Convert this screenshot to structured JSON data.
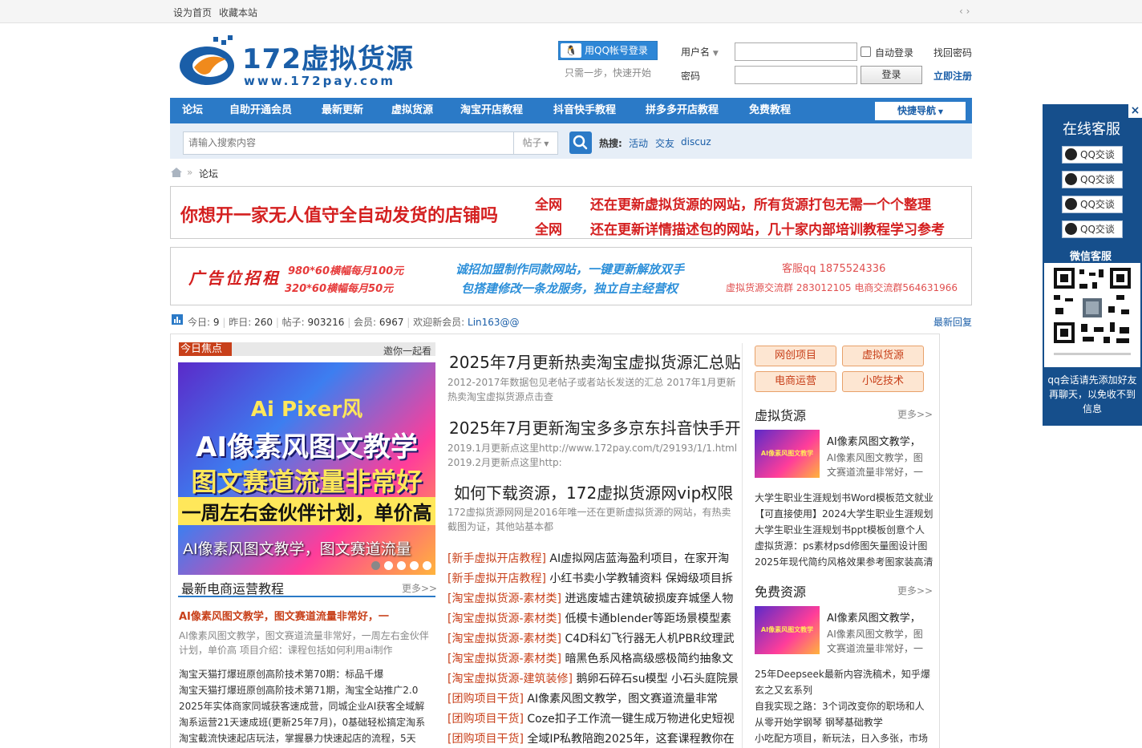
{
  "topbar": {
    "set_home": "设为首页",
    "bookmark": "收藏本站",
    "toggle": "‹ ›"
  },
  "logo": {
    "title": "172虚拟货源",
    "url": "www.172pay.com"
  },
  "login": {
    "qq_button": "用QQ帐号登录",
    "qq_hint": "只需一步，快速开始",
    "username_label": "用户名",
    "password_label": "密码",
    "auto_login": "自动登录",
    "login_button": "登录",
    "find_password": "找回密码",
    "register": "立即注册"
  },
  "nav": {
    "items": [
      "论坛",
      "自助开通会员",
      "最新更新",
      "虚拟货源",
      "淘宝开店教程",
      "抖音快手教程",
      "拼多多开店教程",
      "免费教程"
    ],
    "quick_nav": "快捷导航"
  },
  "search": {
    "placeholder": "请输入搜索内容",
    "type": "帖子",
    "hot_label": "热搜:",
    "hot": [
      "活动",
      "交友",
      "discuz"
    ]
  },
  "breadcrumb": {
    "current": "论坛"
  },
  "banner1": {
    "left": "你想开一家无人值守全自动发货的店铺吗",
    "tag1": "全网",
    "line1": "还在更新虚拟货源的网站，所有货源打包无需一个个整理",
    "tag2": "全网",
    "line2": "还在更新详情描述包的网站，几十家内部培训教程学习参考"
  },
  "banner2": {
    "title": "广告位招租",
    "price1": "980*60横幅每月100元",
    "price2": "320*60横幅每月50元",
    "promo1": "诚招加盟制作同款网站，一键更新解放双手",
    "promo2": "包搭建修改一条龙服务，独立自主经营权",
    "kf": "客服qq  1875524336",
    "group": "虚拟货源交流群  283012105  电商交流群564631966"
  },
  "stats": {
    "today_label": "今日:",
    "today": "9",
    "yesterday_label": "昨日:",
    "yesterday": "260",
    "posts_label": "帖子:",
    "posts": "903216",
    "members_label": "会员:",
    "members": "6967",
    "newest_label": "欢迎新会员:",
    "newest": "Lin163@@",
    "latest_reply": "最新回复"
  },
  "focus": {
    "tag": "今日焦点",
    "invite": "邀你一起看",
    "slide_caption": "AI像素风图文教学，图文赛道流量",
    "slide_l1": "Ai Pixer风",
    "slide_l2": "AI像素风图文教学",
    "slide_l3": "图文赛道流量非常好",
    "slide_l4": "一周左右金伙伴计划，单价高"
  },
  "ecom": {
    "title": "最新电商运营教程",
    "more": "更多>>",
    "headline": "AI像素风图文教学，图文赛道流量非常好，一",
    "desc1": "AI像素风图文教学，图文赛道流量非常好，一周左右金伙伴",
    "desc2": "计划，单价高 项目介绍：课程包括如何利用ai制作",
    "list": [
      "淘宝天猫打爆班原创高阶技术第70期：标品千爆",
      "淘宝天猫打爆班原创高阶技术第71期，淘宝全站推广2.0",
      "2025年实体商家同城获客速成营，同城企业AI获客全域解",
      "淘系运营21天速成班(更新25年7月)，0基础轻松搞定淘系",
      "淘宝截流快速起店玩法，掌握暴力快速起店的流程，5天"
    ]
  },
  "middle": {
    "t1": "2025年7月更新热卖淘宝虚拟货源汇总贴",
    "d1": "2012-2017年数据包见老帖子或者站长发送的汇总 2017年1月更新热卖淘宝虚拟货源点击查",
    "t2": "2025年7月更新淘宝多多京东抖音快手开",
    "d2a": "2019.1月更新点这里http://www.172pay.com/t/29193/1/1.html",
    "d2b": "2019.2月更新点这里http:",
    "t3": "如何下载资源，172虚拟货源网vip权限",
    "d3": "172虚拟货源网网是2016年唯一还在更新虚拟货源的网站，有热卖截图为证，其他站基本都",
    "items": [
      {
        "tag": "[新手虚拟开店教程]",
        "text": "AI虚拟网店蓝海盈利项目，在家开淘"
      },
      {
        "tag": "[新手虚拟开店教程]",
        "text": "小红书卖小学教辅资料 保姆级项目拆"
      },
      {
        "tag": "[淘宝虚拟货源-素材类]",
        "text": "迸逃废墟古建筑破损废弃城堡人物"
      },
      {
        "tag": "[淘宝虚拟货源-素材类]",
        "text": "低模卡通blender等距场景模型素"
      },
      {
        "tag": "[淘宝虚拟货源-素材类]",
        "text": "C4D科幻飞行器无人机PBR纹理武"
      },
      {
        "tag": "[淘宝虚拟货源-素材类]",
        "text": "暗黑色系风格高级感极简约抽象文"
      },
      {
        "tag": "[淘宝虚拟货源-建筑装修]",
        "text": "鹅卵石碎石su模型 小石头庭院景"
      },
      {
        "tag": "[团购项目干货]",
        "text": "AI像素风图文教学，图文赛道流量非常"
      },
      {
        "tag": "[团购项目干货]",
        "text": "Coze扣子工作流一键生成万物进化史短视"
      },
      {
        "tag": "[团购项目干货]",
        "text": "全域IP私教陪跑2025年，这套课程教你在"
      }
    ]
  },
  "right": {
    "buttons": [
      "网创项目",
      "虚拟货源",
      "电商运营",
      "小吃技术"
    ],
    "virtual": {
      "title": "虚拟货源",
      "more": "更多>>",
      "thumb_title": "AI像素风图文教学，",
      "thumb_desc1": "AI像素风图文教学，图",
      "thumb_desc2": "文赛道流量非常好，一",
      "thumb_text": "AI像素风图文教学",
      "list": [
        "大学生职业生涯规划书Word模板范文就业",
        "【可直接使用】2024大学生职业生涯规划",
        "大学生职业生涯规划书ppt模板创意个人",
        "虚拟货源：ps素材psd修图矢量图设计图",
        "2025年现代简约风格效果参考图家装高清"
      ]
    },
    "free": {
      "title": "免费资源",
      "more": "更多>>",
      "thumb_title": "AI像素风图文教学，",
      "thumb_desc1": "AI像素风图文教学，图",
      "thumb_desc2": "文赛道流量非常好，一",
      "thumb_text": "AI像素风图文教学",
      "list": [
        "25年Deepseek最新内容洗稿术，知乎爆",
        "玄之又玄系列",
        "自我实现之路：3个词改变你的职场和人",
        "从零开始学钢琴 钢琴基础教学",
        "小吃配方项目，新玩法，日入多张，市场"
      ]
    }
  },
  "sidebar": {
    "title": "在线客服",
    "qq_label": "QQ交谈",
    "wechat": "微信客服",
    "note": "qq会话请先添加好友再聊天，以免收不到信息",
    "close": "×"
  },
  "colors": {
    "brand": "#2b7ac7",
    "accent": "#c8401a",
    "sidebar": "#164f8c"
  }
}
